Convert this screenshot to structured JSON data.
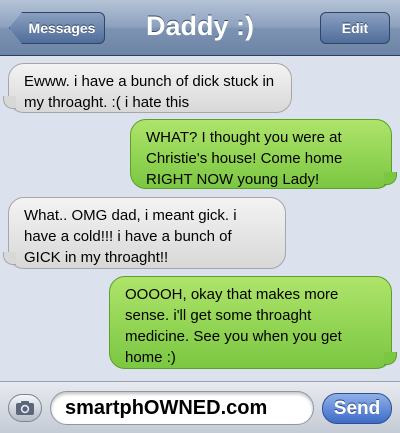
{
  "navbar": {
    "back_label": "Messages",
    "title": "Daddy :)",
    "edit_label": "Edit"
  },
  "messages": [
    {
      "sender": "received",
      "text": "Ewww. i have a bunch of dick stuck in my throaght. :( i hate this"
    },
    {
      "sender": "sent",
      "text": "WHAT? I thought you were at Christie's house! Come home RIGHT NOW young Lady!"
    },
    {
      "sender": "received",
      "text": "What.. OMG dad, i meant gick. i have a cold!!! i have a bunch of GICK in my throaght!!"
    },
    {
      "sender": "sent",
      "text": "OOOOH, okay that makes more sense. i'll get some throaght medicine. See you when you get home :)"
    }
  ],
  "input": {
    "value": "smartphOWNED.com",
    "send_label": "Send",
    "camera_icon": "camera-icon"
  },
  "colors": {
    "sent_bubble": "#7bc742",
    "received_bubble": "#e4e4e4",
    "navbar": "#8ea2bf",
    "background": "#dbe2ed",
    "send_button": "#3e6bc8"
  }
}
